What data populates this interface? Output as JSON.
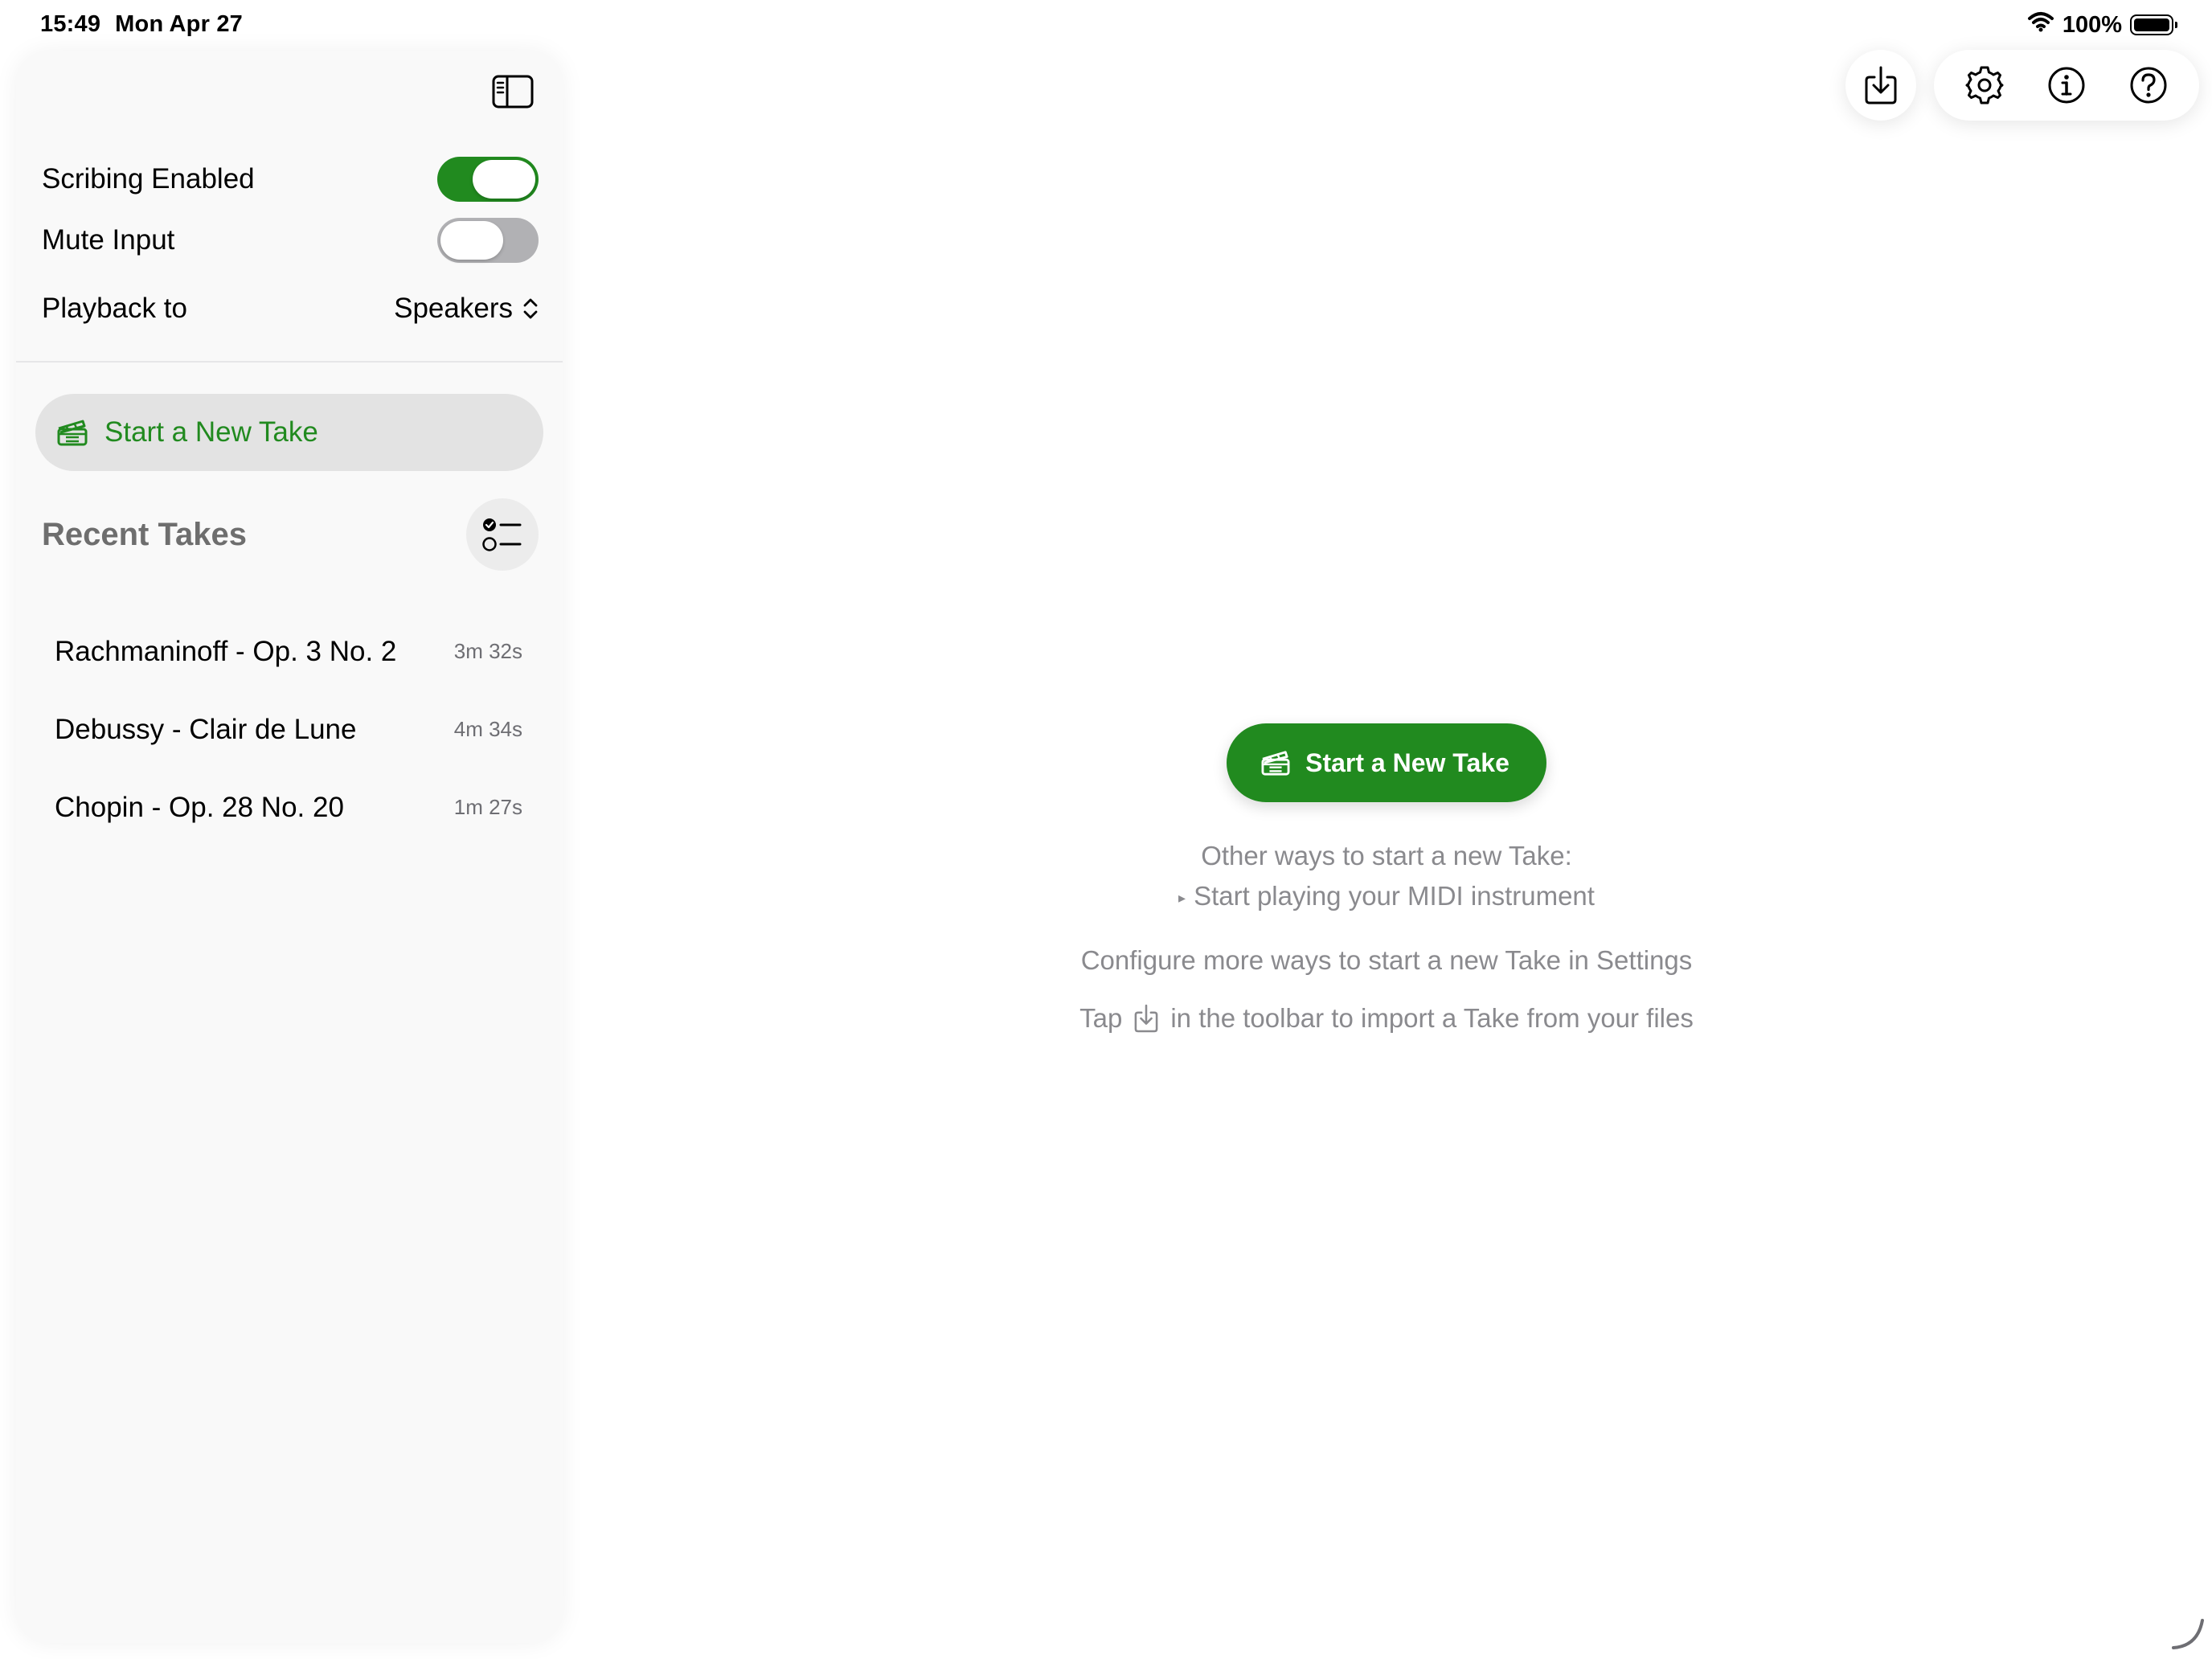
{
  "status_bar": {
    "time": "15:49",
    "date": "Mon Apr 27",
    "battery": "100%"
  },
  "sidebar": {
    "scribing_label": "Scribing Enabled",
    "scribing_enabled": true,
    "mute_label": "Mute Input",
    "mute_enabled": false,
    "playback_label": "Playback to",
    "playback_value": "Speakers",
    "new_take_label": "Start a New Take",
    "recent_title": "Recent Takes",
    "takes": [
      {
        "title": "Rachmaninoff - Op. 3 No. 2",
        "duration": "3m 32s"
      },
      {
        "title": "Debussy - Clair de Lune",
        "duration": "4m 34s"
      },
      {
        "title": "Chopin - Op. 28 No. 20",
        "duration": "1m 27s"
      }
    ]
  },
  "main": {
    "new_take_label": "Start a New Take",
    "other_ways": "Other ways to start a new Take:",
    "midi_hint": "Start playing your MIDI instrument",
    "configure_hint": "Configure more ways to start a new Take in Settings",
    "tap_prefix": "Tap",
    "tap_suffix": "in the toolbar to import a Take from your files"
  },
  "colors": {
    "accent": "#218a1f",
    "secondary_text": "#8a8a8e"
  }
}
